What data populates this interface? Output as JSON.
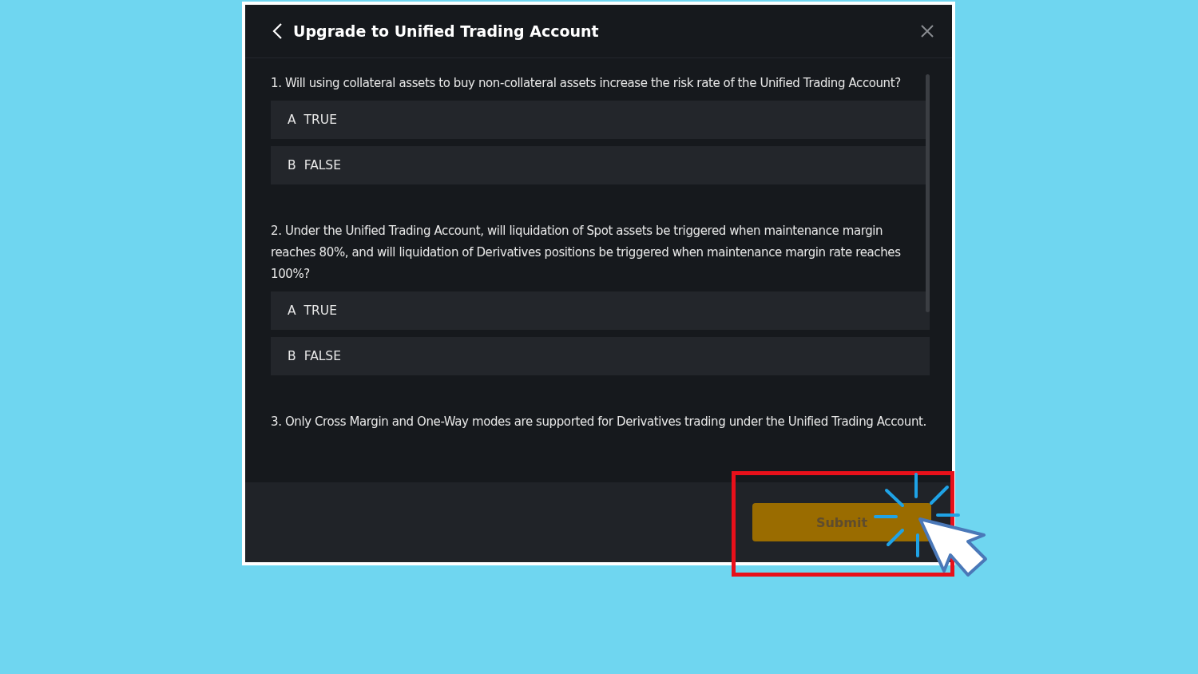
{
  "dialog": {
    "title": "Upgrade to Unified Trading Account"
  },
  "questions": [
    {
      "text": "1. Will using collateral assets to buy non-collateral assets increase the risk rate of the Unified Trading Account?",
      "options": [
        {
          "letter": "A",
          "label": "TRUE",
          "selected": false
        },
        {
          "letter": "B",
          "label": "FALSE",
          "selected": false
        }
      ]
    },
    {
      "text": "2. Under the Unified Trading Account, will liquidation of Spot assets be triggered when maintenance margin reaches 80%, and will liquidation of Derivatives positions be triggered when maintenance margin rate reaches 100%?",
      "options": [
        {
          "letter": "A",
          "label": "TRUE",
          "selected": false
        },
        {
          "letter": "B",
          "label": "FALSE",
          "selected": false
        }
      ]
    },
    {
      "text": "3. Only Cross Margin and One-Way modes are supported for Derivatives trading under the Unified Trading Account."
    }
  ],
  "submit": {
    "label": "Submit",
    "disabled": true
  }
}
